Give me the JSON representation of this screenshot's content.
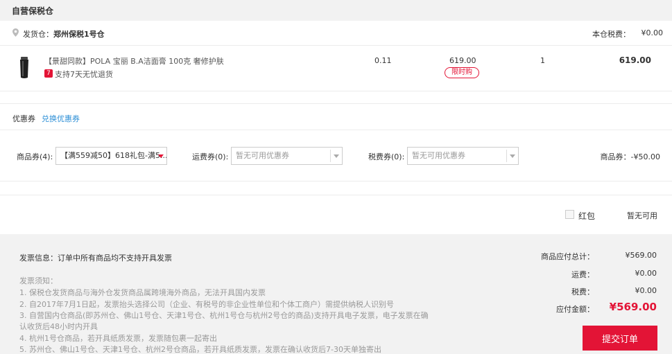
{
  "header": {
    "title": "自营保税仓"
  },
  "shipping": {
    "from_label": "发货仓：",
    "from_value": "郑州保税1号仓",
    "tax_label": "本仓税费：",
    "tax_value": "¥0.00"
  },
  "product": {
    "name": "【景甜同款】POLA 宝丽 B.A洁面膏 100克 奢修护肤",
    "refund_badge": "7",
    "refund_text": "支持7天无忧退货",
    "tax": "0.11",
    "price": "619.00",
    "limit_tag": "限时购",
    "quantity": "1",
    "subtotal": "619.00"
  },
  "coupon": {
    "title": "优惠券",
    "exchange_link": "兑换优惠券",
    "goods_label": "商品券(4):",
    "goods_selected": "【满559减50】618礼包-满5...",
    "shipping_label": "运费券(0):",
    "shipping_placeholder": "暂无可用优惠券",
    "tax_label": "税费券(0):",
    "tax_placeholder": "暂无可用优惠券",
    "discount_text": "商品券：-¥50.00"
  },
  "redpack": {
    "label": "红包",
    "status": "暂无可用"
  },
  "invoice": {
    "info": "发票信息：订单中所有商品均不支持开具发票",
    "notice_title": "发票须知：",
    "notices": [
      "1. 保税仓发货商品与海外仓发货商品属跨境海外商品，无法开具国内发票",
      "2. 自2017年7月1日起，发票抬头选择公司（企业、有税号的非企业性单位和个体工商户）需提供纳税人识别号",
      "3. 自营国内仓商品(即苏州仓、佛山1号仓、天津1号仓、杭州1号仓与杭州2号仓的商品)支持开具电子发票，电子发票在确",
      "认收货后48小时内开具",
      "4. 杭州1号仓商品，若开具纸质发票，发票随包裹一起寄出",
      "5. 苏州仓、佛山1号仓、天津1号仓、杭州2号仓商品，若开具纸质发票，发票在确认收货后7-30天单独寄出"
    ]
  },
  "summary": {
    "goods_total_label": "商品应付总计：",
    "goods_total_value": "¥569.00",
    "shipping_label": "运费：",
    "shipping_value": "¥0.00",
    "tax_label": "税费：",
    "tax_value": "¥0.00",
    "total_label": "应付金额：",
    "total_value": "¥569.00",
    "submit_label": "提交订单"
  },
  "colors": {
    "accent": "#e31436",
    "link": "#2d8fd6",
    "panel": "#f2f2f2"
  },
  "icons": {
    "location": "location-pin-icon",
    "product": "product-thumbnail"
  }
}
